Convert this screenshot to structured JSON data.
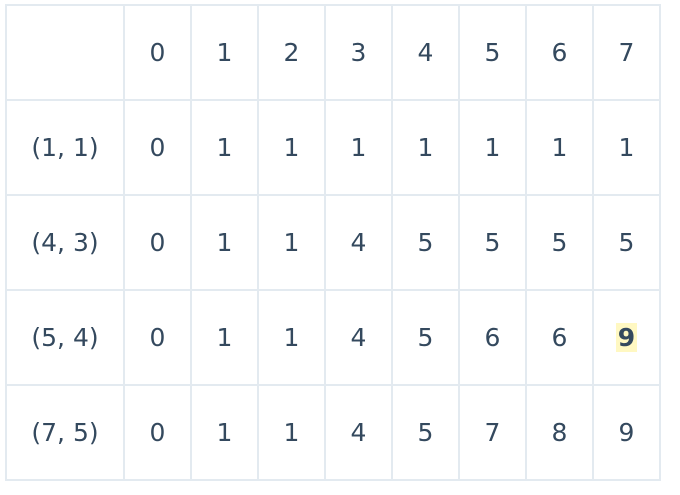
{
  "table": {
    "corner": "",
    "columns": [
      "0",
      "1",
      "2",
      "3",
      "4",
      "5",
      "6",
      "7"
    ],
    "rows": [
      {
        "label": "(1, 1)",
        "cells": [
          "0",
          "1",
          "1",
          "1",
          "1",
          "1",
          "1",
          "1"
        ]
      },
      {
        "label": "(4, 3)",
        "cells": [
          "0",
          "1",
          "1",
          "4",
          "5",
          "5",
          "5",
          "5"
        ]
      },
      {
        "label": "(5, 4)",
        "cells": [
          "0",
          "1",
          "1",
          "4",
          "5",
          "6",
          "6",
          "9"
        ]
      },
      {
        "label": "(7, 5)",
        "cells": [
          "0",
          "1",
          "1",
          "4",
          "5",
          "7",
          "8",
          "9"
        ]
      }
    ],
    "highlight": {
      "row": 2,
      "col": 7,
      "color": "#fff8c2"
    }
  }
}
